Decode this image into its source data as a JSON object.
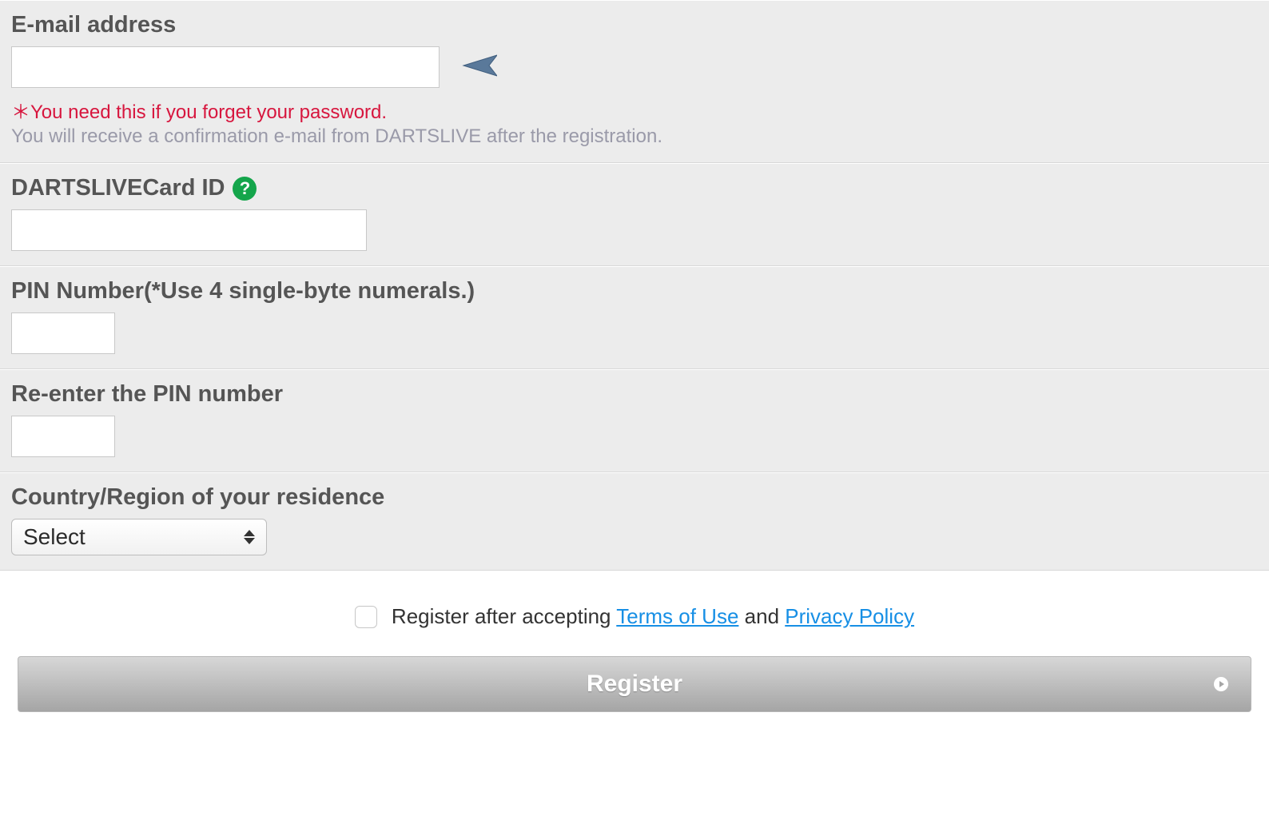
{
  "email": {
    "label": "E-mail address",
    "value": "",
    "warning_prefix": "＊",
    "warning": "You need this if you forget your password.",
    "info": "You will receive a confirmation e-mail from DARTSLIVE after the registration."
  },
  "card_id": {
    "label": "DARTSLIVECard ID",
    "help_symbol": "?",
    "value": ""
  },
  "pin": {
    "label": "PIN Number(*Use 4 single-byte numerals.)",
    "value": ""
  },
  "pin_confirm": {
    "label": "Re-enter the PIN number",
    "value": ""
  },
  "country": {
    "label": "Country/Region of your residence",
    "selected": "Select"
  },
  "agree": {
    "prefix": "Register after accepting ",
    "terms_link": "Terms of Use",
    "middle": " and ",
    "privacy_link": "Privacy Policy"
  },
  "submit": {
    "label": "Register"
  }
}
